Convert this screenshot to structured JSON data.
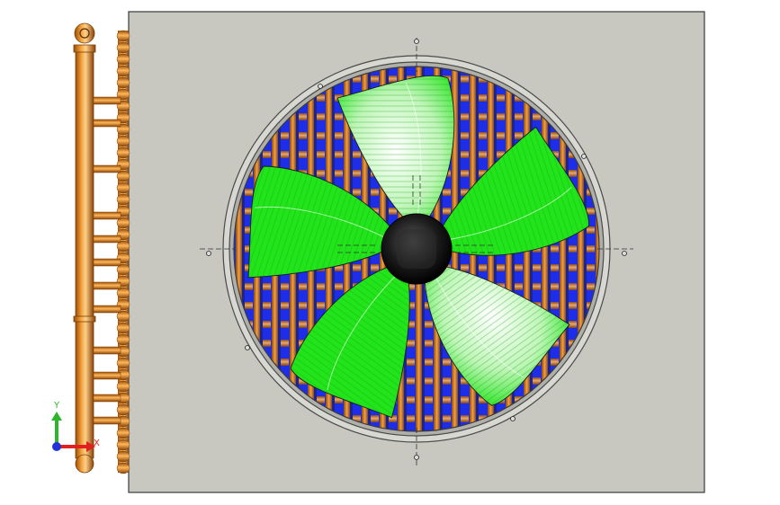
{
  "viewport": {
    "background": "#ffffff",
    "triad": {
      "x_label": "X",
      "y_label": "Y",
      "x_color": "#e0211d",
      "y_color": "#2fb52c",
      "z_color": "#2231d8"
    }
  },
  "model": {
    "panel_color": "#c8c8c0",
    "header_pipe_color": "#e98c1c",
    "fin_blue": "#1d2ee6",
    "fan_blade_color": "#22e41a",
    "hub_color": "#111111",
    "shroud_ring_color": "#b4b4ae",
    "blade_count": 5
  }
}
